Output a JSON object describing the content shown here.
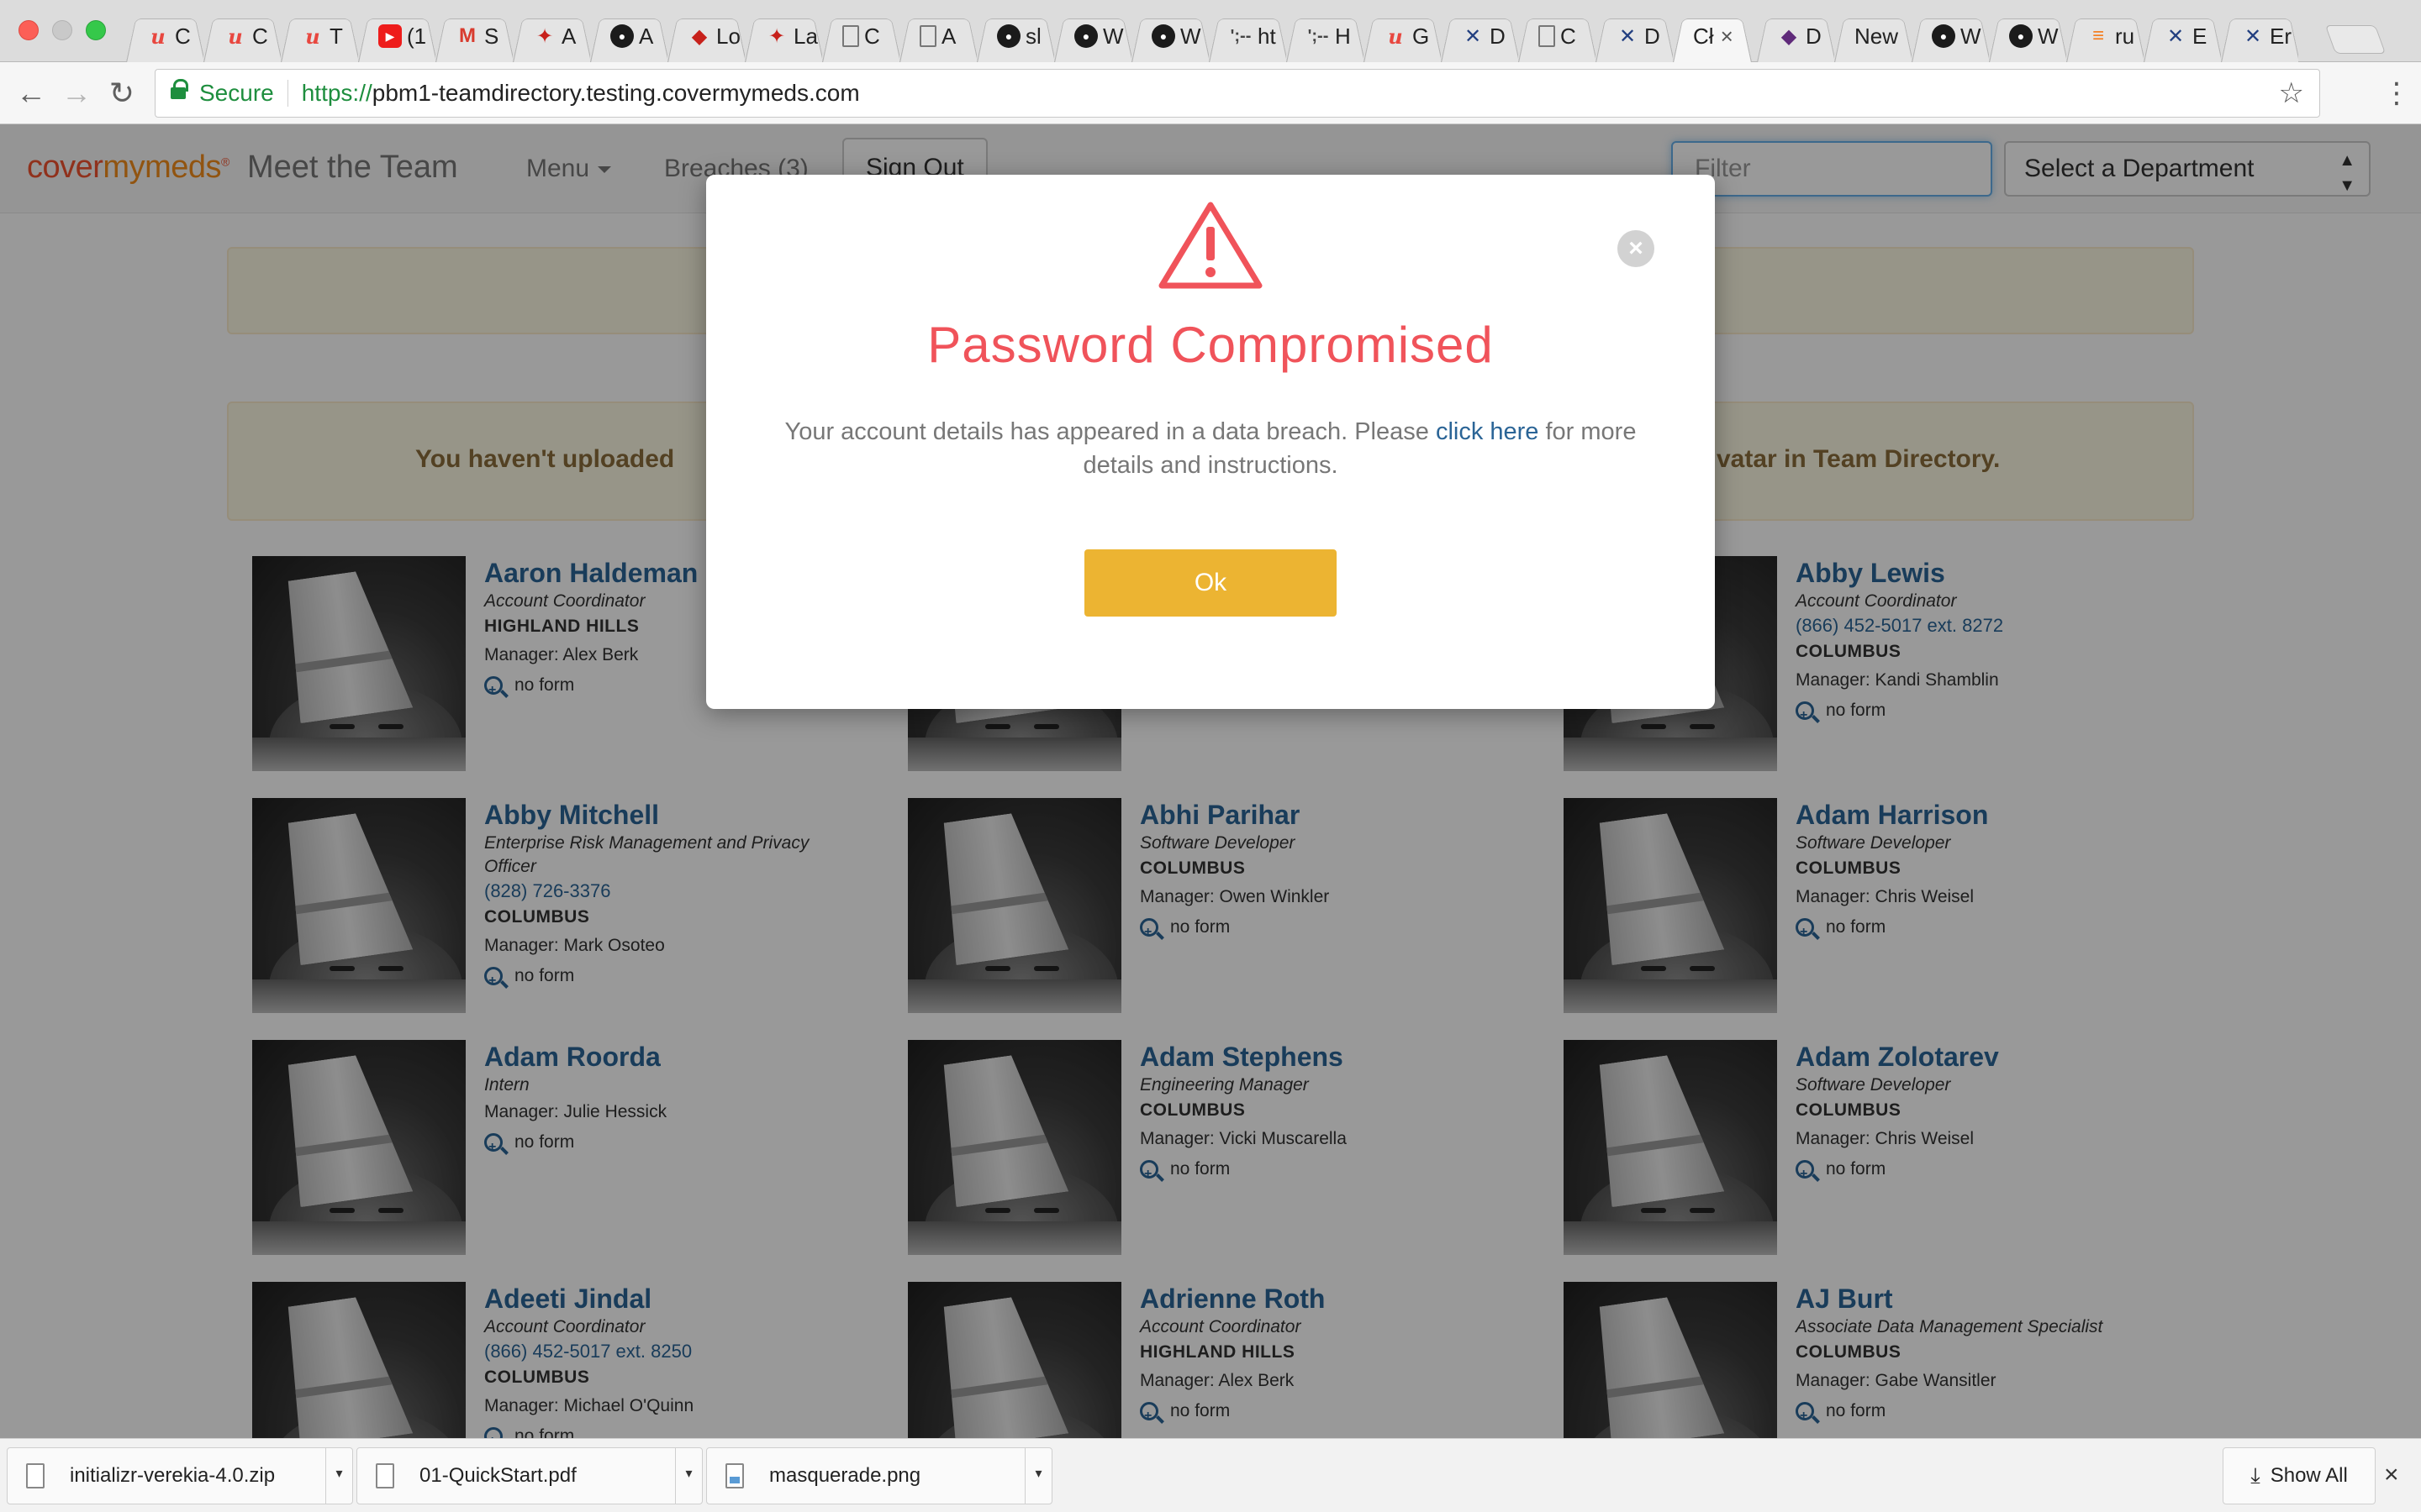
{
  "browser": {
    "tabs": [
      {
        "icon": "udemy-icon",
        "glyph": "u",
        "label": "C"
      },
      {
        "icon": "udemy-icon",
        "glyph": "u",
        "label": "C"
      },
      {
        "icon": "udemy-icon",
        "glyph": "u",
        "label": "T"
      },
      {
        "icon": "youtube-icon",
        "glyph": "▶",
        "label": "(1"
      },
      {
        "icon": "gmail-icon",
        "glyph": "M",
        "label": "S"
      },
      {
        "icon": "rspec-icon",
        "glyph": "✦",
        "label": "A"
      },
      {
        "icon": "github-icon",
        "glyph": "●",
        "label": "A"
      },
      {
        "icon": "page-icon",
        "glyph": "◆",
        "label": "Lo"
      },
      {
        "icon": "rspec-icon",
        "glyph": "✦",
        "label": "La"
      },
      {
        "icon": "document-icon",
        "glyph": "",
        "label": "C"
      },
      {
        "icon": "document-icon",
        "glyph": "",
        "label": "A"
      },
      {
        "icon": "github-icon",
        "glyph": "●",
        "label": "sl"
      },
      {
        "icon": "github-icon",
        "glyph": "●",
        "label": "W"
      },
      {
        "icon": "github-icon",
        "glyph": "●",
        "label": "W"
      },
      {
        "icon": "code-icon",
        "glyph": "';--",
        "label": "ht"
      },
      {
        "icon": "code-icon",
        "glyph": "';--",
        "label": "H"
      },
      {
        "icon": "udemy-icon",
        "glyph": "u",
        "label": "G"
      },
      {
        "icon": "covermymeds-icon",
        "glyph": "✕",
        "label": "D"
      },
      {
        "icon": "document-icon",
        "glyph": "",
        "label": "C"
      },
      {
        "icon": "covermymeds-icon",
        "glyph": "✕",
        "label": "D"
      },
      {
        "icon": "blank-icon",
        "glyph": "",
        "label": "Cł",
        "active": true
      },
      {
        "icon": "eggplant-icon",
        "glyph": "◆",
        "label": "D"
      },
      {
        "icon": "blank-icon",
        "glyph": "",
        "label": "New"
      },
      {
        "icon": "github-icon",
        "glyph": "●",
        "label": "W"
      },
      {
        "icon": "github-icon",
        "glyph": "●",
        "label": "W"
      },
      {
        "icon": "stackoverflow-icon",
        "glyph": "≡",
        "label": "ru"
      },
      {
        "icon": "covermymeds-icon",
        "glyph": "✕",
        "label": "E"
      },
      {
        "icon": "covermymeds-icon",
        "glyph": "✕",
        "label": "Er"
      }
    ],
    "secure_label": "Secure",
    "url_scheme": "https://",
    "url_host": "pbm1-teamdirectory.testing.covermymeds.com"
  },
  "navbar": {
    "brand_cover": "cover",
    "brand_mymeds": "mymeds",
    "app_title": "Meet the Team",
    "menu_label": "Menu",
    "breaches_label": "Breaches (3)",
    "signout_label": "Sign Out",
    "filter_placeholder": "Filter",
    "dept_label": "Select a Department"
  },
  "alerts": {
    "avatar_notice_left": "You haven't uploaded",
    "avatar_notice_right": "vatar in Team Directory."
  },
  "people": [
    {
      "name": "Aaron Haldeman",
      "role": "Account Coordinator",
      "phone": "",
      "location": "HIGHLAND HILLS",
      "manager": "Manager: Alex Berk",
      "form": "no form"
    },
    {
      "name": "",
      "role": "",
      "phone": "",
      "location": "",
      "manager": "",
      "form": ""
    },
    {
      "name": "Abby Lewis",
      "role": "Account Coordinator",
      "phone": "(866) 452-5017 ext. 8272",
      "location": "COLUMBUS",
      "manager": "Manager: Kandi Shamblin",
      "form": "no form"
    },
    {
      "name": "Abby Mitchell",
      "role": "Enterprise Risk Management and Privacy Officer",
      "phone": "(828) 726-3376",
      "location": "COLUMBUS",
      "manager": "Manager: Mark Osoteo",
      "form": "no form"
    },
    {
      "name": "Abhi Parihar",
      "role": "Software Developer",
      "phone": "",
      "location": "COLUMBUS",
      "manager": "Manager: Owen Winkler",
      "form": "no form"
    },
    {
      "name": "Adam Harrison",
      "role": "Software Developer",
      "phone": "",
      "location": "COLUMBUS",
      "manager": "Manager: Chris Weisel",
      "form": "no form"
    },
    {
      "name": "Adam Roorda",
      "role": "Intern",
      "phone": "",
      "location": "",
      "manager": "Manager: Julie Hessick",
      "form": "no form"
    },
    {
      "name": "Adam Stephens",
      "role": "Engineering Manager",
      "phone": "",
      "location": "COLUMBUS",
      "manager": "Manager: Vicki Muscarella",
      "form": "no form"
    },
    {
      "name": "Adam Zolotarev",
      "role": "Software Developer",
      "phone": "",
      "location": "COLUMBUS",
      "manager": "Manager: Chris Weisel",
      "form": "no form"
    },
    {
      "name": "Adeeti Jindal",
      "role": "Account Coordinator",
      "phone": "(866) 452-5017 ext. 8250",
      "location": "COLUMBUS",
      "manager": "Manager: Michael O'Quinn",
      "form": "no form"
    },
    {
      "name": "Adrienne Roth",
      "role": "Account Coordinator",
      "phone": "",
      "location": "HIGHLAND HILLS",
      "manager": "Manager: Alex Berk",
      "form": "no form"
    },
    {
      "name": "AJ Burt",
      "role": "Associate Data Management Specialist",
      "phone": "",
      "location": "COLUMBUS",
      "manager": "Manager: Gabe Wansitler",
      "form": "no form"
    }
  ],
  "modal": {
    "title": "Password Compromised",
    "text_before": "Your account details has appeared in a data breach. Please ",
    "link": "click here",
    "text_after": " for more details and instructions.",
    "ok_label": "Ok",
    "accent_color": "#f0535a",
    "button_color": "#ecb432"
  },
  "downloads": {
    "items": [
      {
        "name": "initializr-verekia-4.0.zip",
        "icon": "zip-file-icon"
      },
      {
        "name": "01-QuickStart.pdf",
        "icon": "pdf-file-icon"
      },
      {
        "name": "masquerade.png",
        "icon": "image-file-icon"
      }
    ],
    "show_all_label": "Show All"
  }
}
